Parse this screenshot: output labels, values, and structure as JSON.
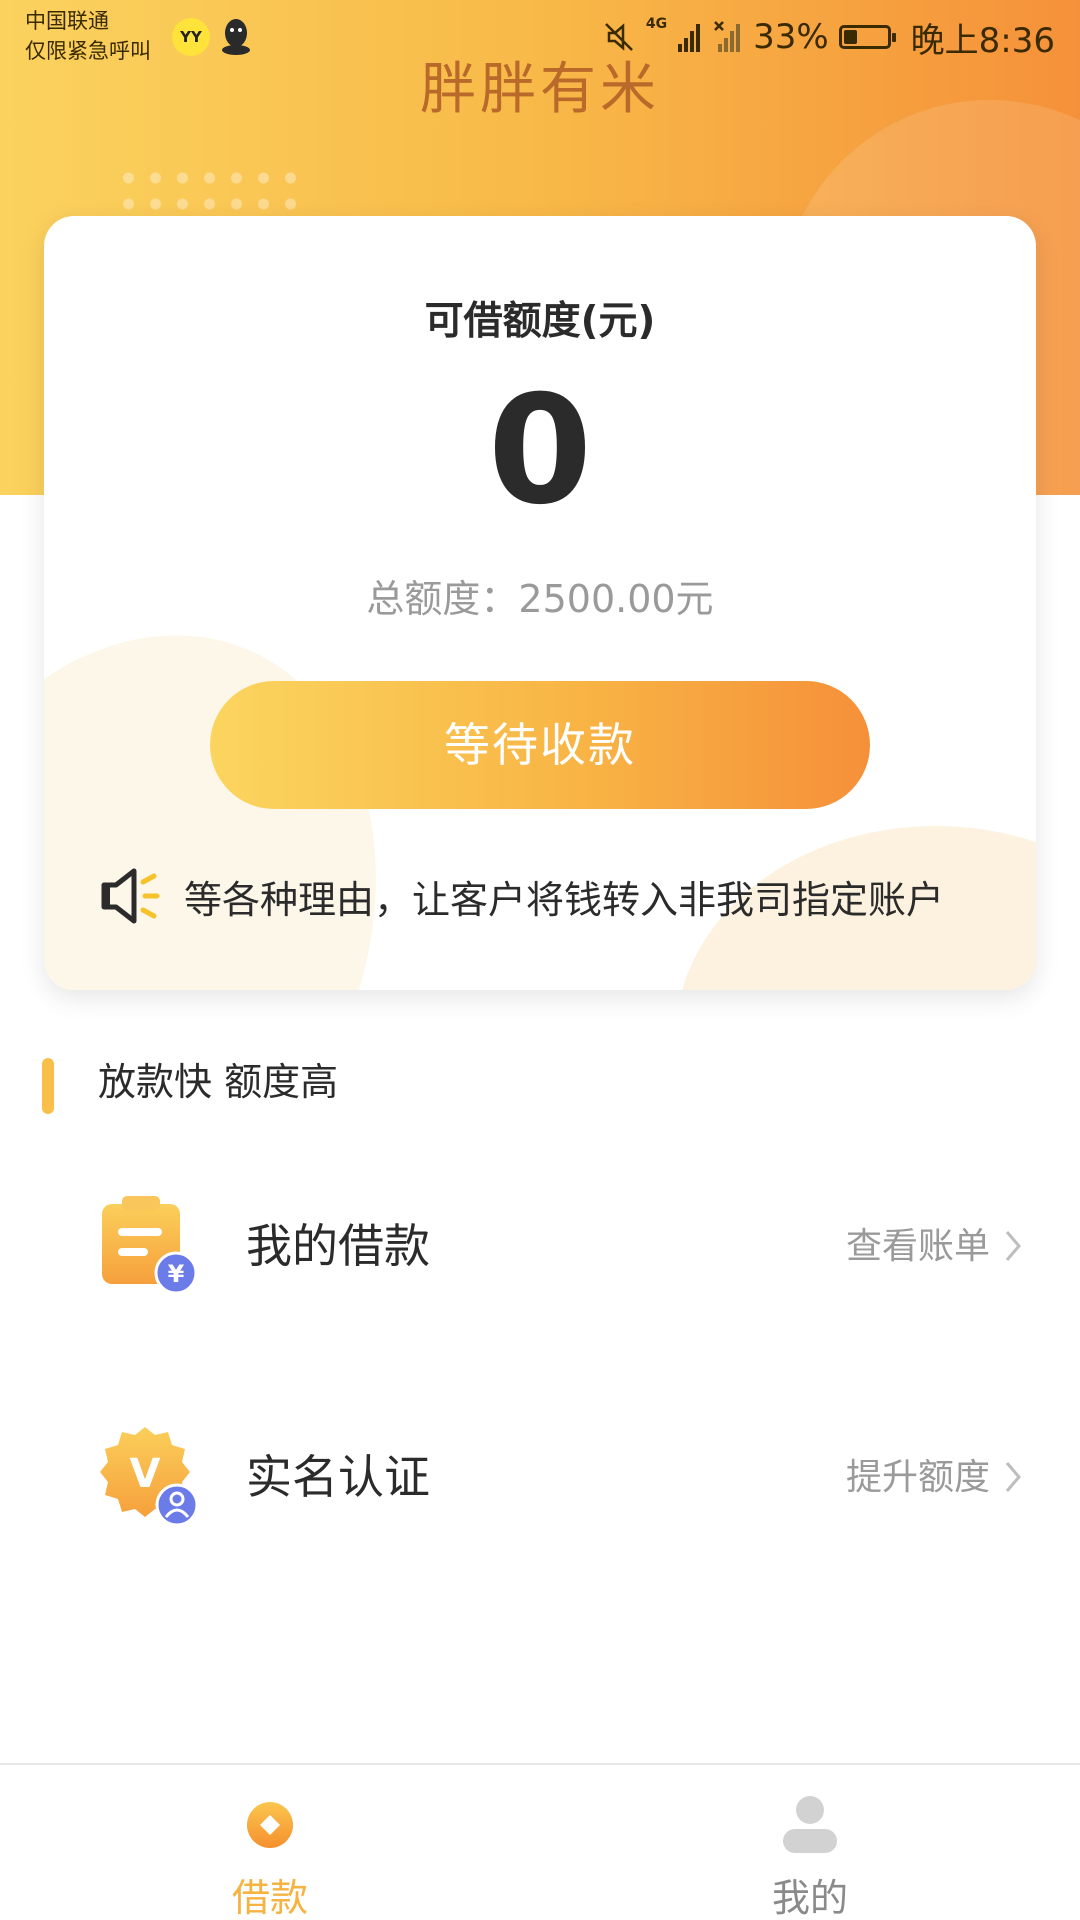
{
  "status_bar": {
    "carrier": "中国联通",
    "carrier_note": "仅限紧急呼叫",
    "yy_label": "YY",
    "network": "4G",
    "battery": "33%",
    "battery_level": 0.33,
    "time": "晚上8:36"
  },
  "app": {
    "title": "胖胖有米"
  },
  "card": {
    "label": "可借额度(元)",
    "amount": "0",
    "total": "总额度：2500.00元",
    "button_label": "等待收款",
    "notice": "等各种理由，让客户将钱转入非我司指定账户"
  },
  "section": {
    "title": "放款快 额度高"
  },
  "rows": [
    {
      "label": "我的借款",
      "action": "查看账单"
    },
    {
      "label": "实名认证",
      "action": "提升额度"
    }
  ],
  "badge": {
    "yen": "¥",
    "v": "V"
  },
  "tabs": [
    {
      "label": "借款",
      "active": true
    },
    {
      "label": "我的",
      "active": false
    }
  ],
  "colors": {
    "accent": "#f8b545",
    "accent_dark": "#f5903a",
    "badge_blue": "#6b7be8",
    "text": "#2b2b2b",
    "muted": "#9a9a9a"
  }
}
